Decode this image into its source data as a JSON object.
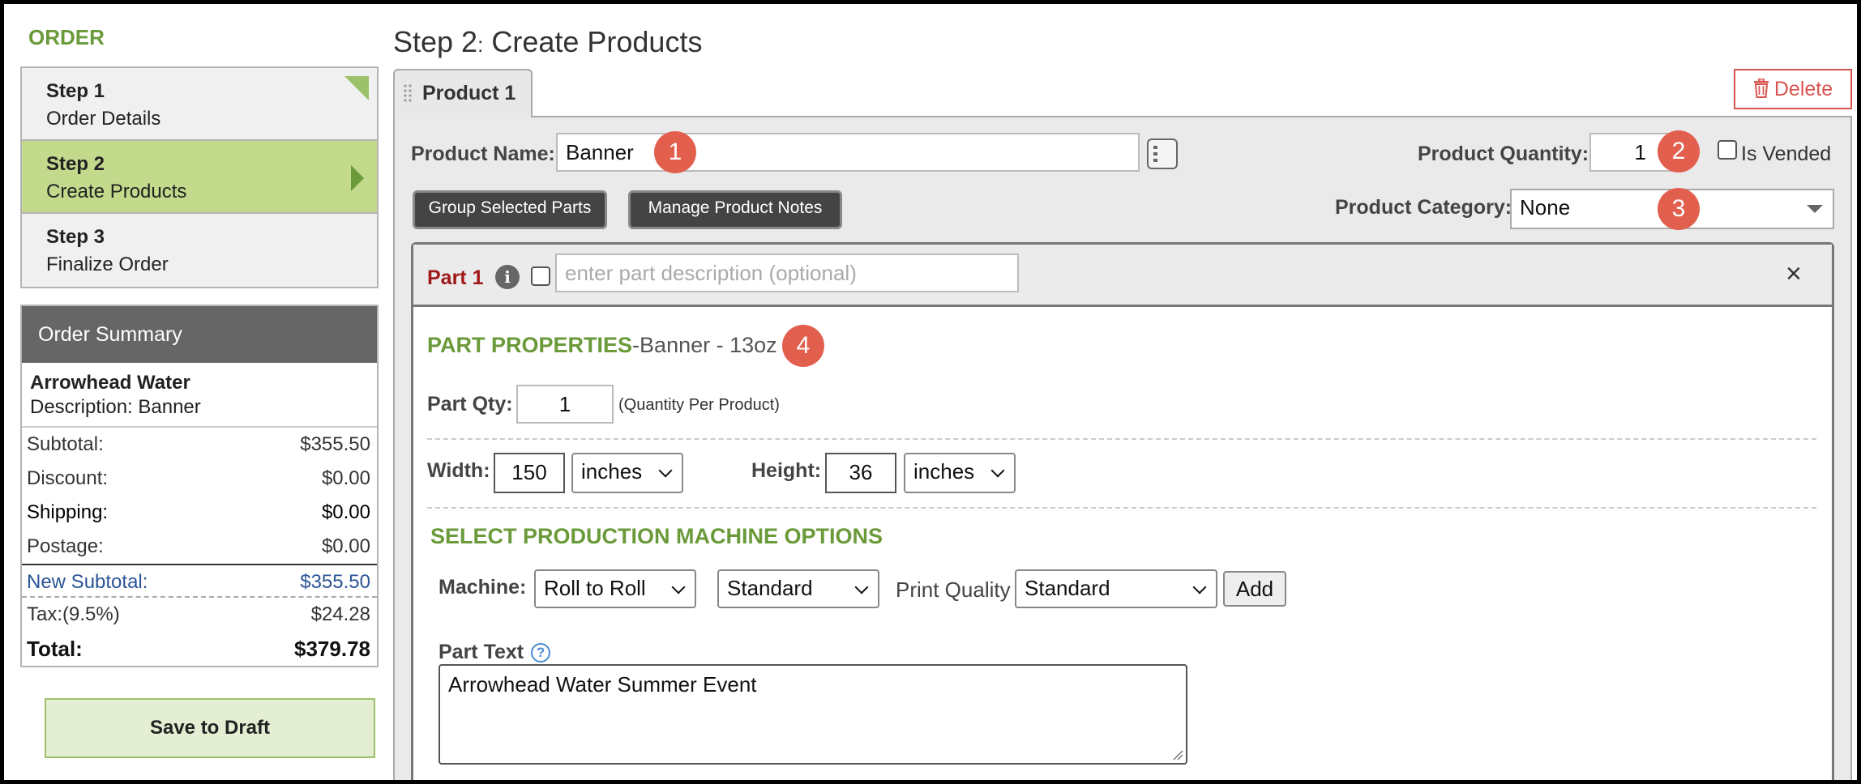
{
  "sidebar": {
    "title": "ORDER",
    "steps": [
      {
        "num": "Step 1",
        "label": "Order Details"
      },
      {
        "num": "Step 2",
        "label": "Create Products"
      },
      {
        "num": "Step 3",
        "label": "Finalize Order"
      }
    ]
  },
  "summary": {
    "header": "Order Summary",
    "customer": "Arrowhead Water",
    "description": "Description:  Banner",
    "rows": [
      {
        "label": "Subtotal:",
        "value": "$355.50"
      },
      {
        "label": "Discount:",
        "value": "$0.00"
      },
      {
        "label": "Shipping:",
        "value": "$0.00"
      },
      {
        "label": "Postage:",
        "value": "$0.00"
      },
      {
        "label": "New Subtotal:",
        "value": "$355.50"
      },
      {
        "label": "Tax:(9.5%)",
        "value": "$24.28"
      },
      {
        "label": "Total:",
        "value": "$379.78"
      }
    ],
    "save_draft": "Save to Draft"
  },
  "main": {
    "title_step": "Step 2",
    "title_sep": ":",
    "title_text": " Create Products",
    "tab_label": "Product 1",
    "delete_label": "Delete"
  },
  "product": {
    "name_label": "Product Name:",
    "name_value": "Banner",
    "quantity_label": "Product Quantity:",
    "quantity_value": "1",
    "vended_label": "Is Vended",
    "category_label": "Product Category:",
    "category_value": "None",
    "group_btn": "Group Selected Parts",
    "notes_btn": "Manage Product Notes"
  },
  "badges": [
    "1",
    "2",
    "3",
    "4"
  ],
  "part": {
    "title": "Part 1",
    "desc_placeholder": "enter part description (optional)",
    "properties_heading": "PART PROPERTIES",
    "properties_sub": "-Banner - 13oz",
    "qty_label": "Part Qty:",
    "qty_value": "1",
    "qty_note": "(Quantity Per Product)",
    "width_label": "Width:",
    "width_value": "150",
    "width_unit": "inches",
    "height_label": "Height:",
    "height_value": "36",
    "height_unit": "inches",
    "machine_heading": "SELECT PRODUCTION MACHINE OPTIONS",
    "machine_label": "Machine:",
    "machine_value": "Roll to Roll",
    "mode_value": "Standard",
    "print_quality_label": "Print Quality",
    "print_quality_value": "Standard",
    "add_btn": "Add",
    "text_label": "Part Text",
    "text_value": "Arrowhead Water Summer Event"
  },
  "colors": {
    "accent_green": "#6a9a3a",
    "active_step": "#c3d98c",
    "badge_red": "#e25f4e",
    "delete_red": "#d9534f",
    "part_red": "#a01818",
    "subtotal_blue": "#2b5596"
  },
  "icons": [
    "trash-icon",
    "drag-grip-icon",
    "list-picker-icon",
    "info-icon",
    "close-icon",
    "help-icon",
    "chevron-down-icon"
  ]
}
